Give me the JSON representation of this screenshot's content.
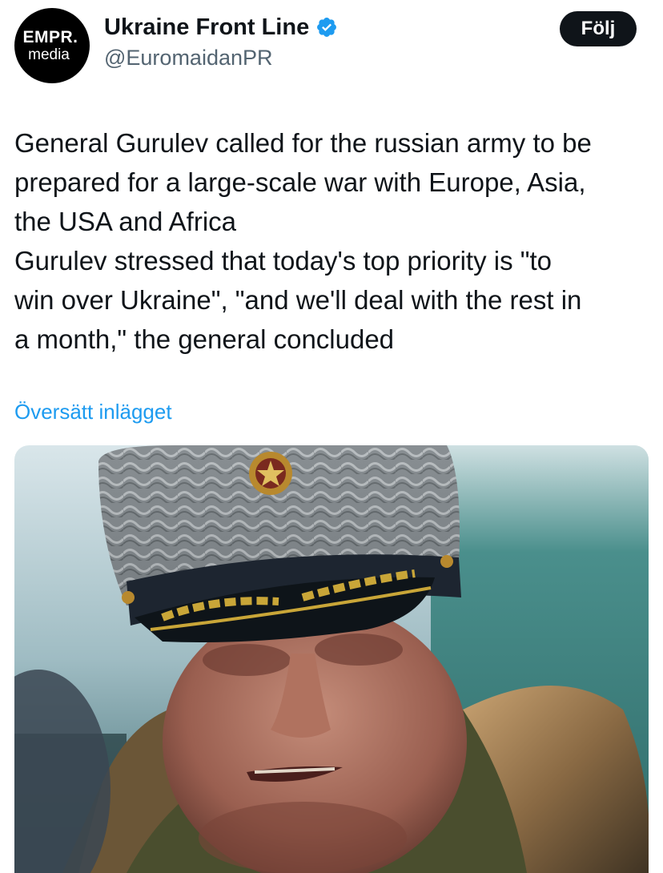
{
  "account": {
    "avatar_line1": "EMPR.",
    "avatar_line2": "media",
    "name": "Ukraine Front Line",
    "handle": "@EuromaidanPR",
    "verified_icon": "verified-badge-icon",
    "follow_label": "Följ"
  },
  "post": {
    "lines": [
      "General Gurulev called for the russian army to be",
      "prepared for a large-scale war with Europe, Asia,",
      "the USA and Africa",
      "Gurulev stressed that today's top priority is \"to",
      "win over Ukraine\", \"and we'll deal with the rest in",
      "a month,\" the general concluded"
    ],
    "translate_label": "Översätt inlägget"
  },
  "colors": {
    "text": "#0f1419",
    "secondary": "#536471",
    "link": "#1d9bf0",
    "verified": "#1d9bf0",
    "follow_bg": "#0f1419"
  }
}
